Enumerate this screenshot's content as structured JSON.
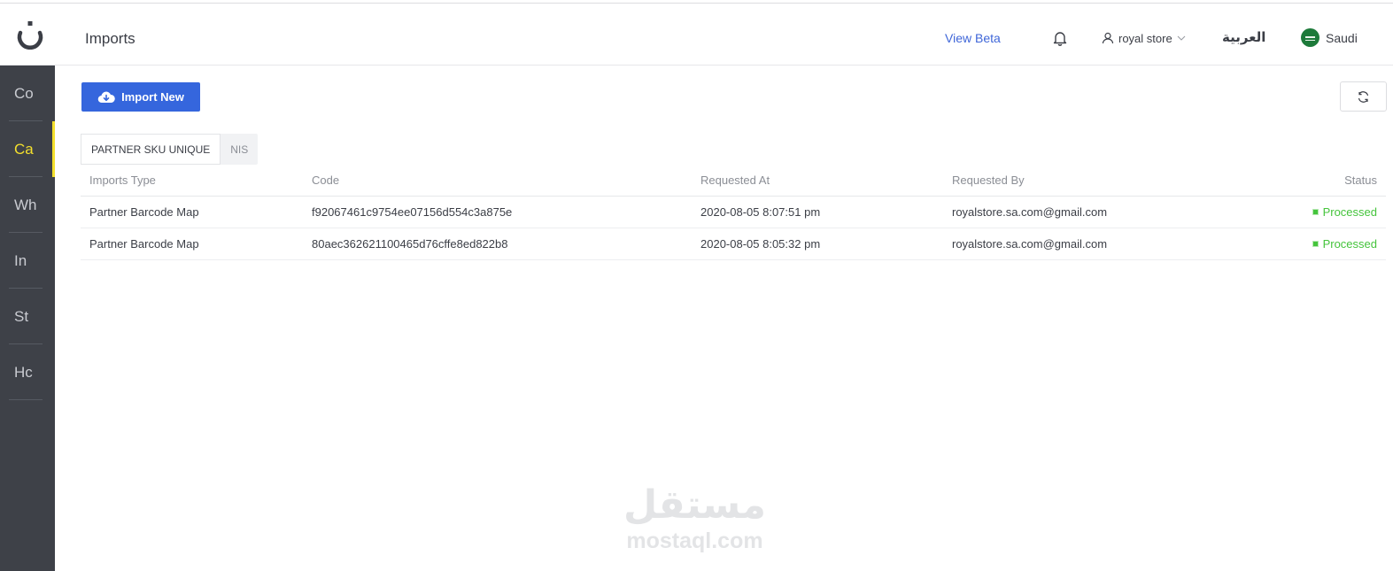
{
  "header": {
    "title": "Imports",
    "view_beta": "View Beta",
    "user": "royal store",
    "language": "العربية",
    "country": "Saudi"
  },
  "sidebar": {
    "items": [
      {
        "label": "Co"
      },
      {
        "label": "Ca"
      },
      {
        "label": "Wh"
      },
      {
        "label": "In"
      },
      {
        "label": "St"
      },
      {
        "label": "Hc"
      }
    ],
    "active_index": 1
  },
  "toolbar": {
    "import_label": "Import New"
  },
  "tabs": [
    {
      "label": "PARTNER SKU UNIQUE"
    },
    {
      "label": "NIS"
    }
  ],
  "table": {
    "columns": [
      "Imports Type",
      "Code",
      "Requested At",
      "Requested By",
      "Status"
    ],
    "rows": [
      {
        "type": "Partner Barcode Map",
        "code": "f92067461c9754ee07156d554c3a875e",
        "requested_at": "2020-08-05 8:07:51 pm",
        "requested_by": "royalstore.sa.com@gmail.com",
        "status": "Processed"
      },
      {
        "type": "Partner Barcode Map",
        "code": "80aec362621100465d76cffe8ed822b8",
        "requested_at": "2020-08-05 8:05:32 pm",
        "requested_by": "royalstore.sa.com@gmail.com",
        "status": "Processed"
      }
    ]
  },
  "watermark": {
    "arabic": "مستقل",
    "latin": "mostaql.com"
  },
  "colors": {
    "accent": "#3566dd",
    "sidebar_bg": "#3e4148",
    "active_yellow": "#f3df2d",
    "status_green": "#45c43c"
  }
}
